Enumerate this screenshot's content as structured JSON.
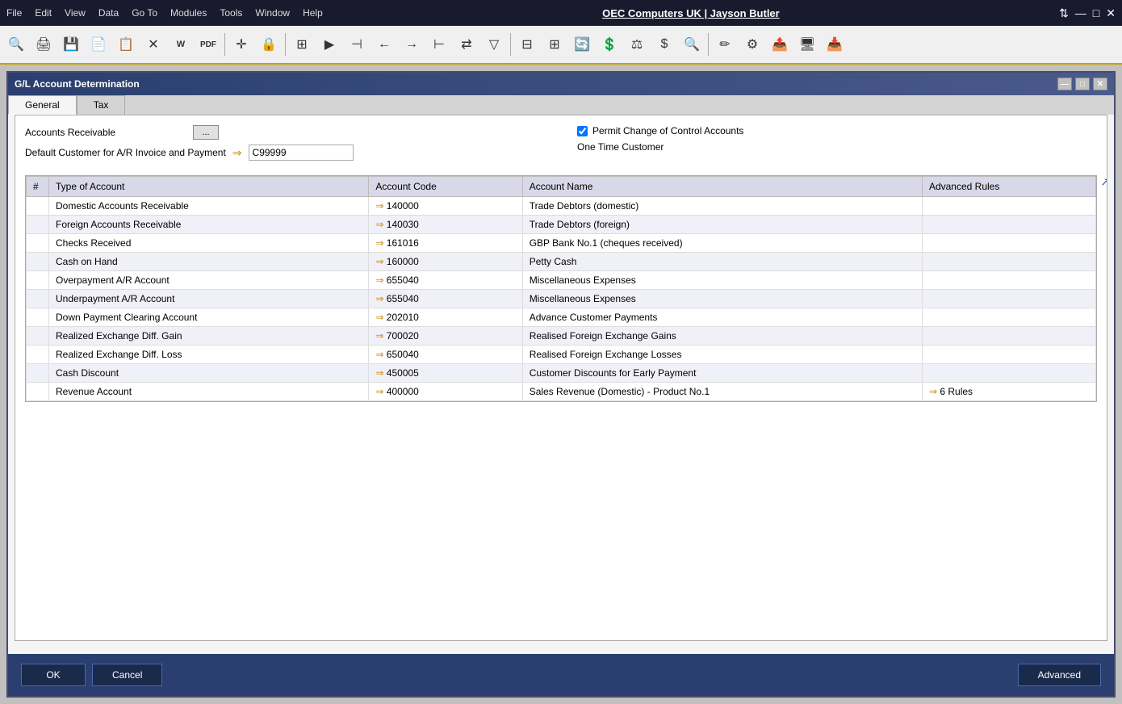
{
  "titlebar": {
    "menu_items": [
      "File",
      "Edit",
      "View",
      "Data",
      "Go To",
      "Modules",
      "Tools",
      "Window",
      "Help"
    ],
    "app_title": "OEC Computers UK | Jayson Butler",
    "controls": [
      "⇅",
      "—",
      "□",
      "✕"
    ]
  },
  "toolbar": {
    "buttons": [
      "🔍",
      "🖨",
      "💾",
      "📄",
      "📋",
      "✕",
      "W",
      "PDF",
      "✛",
      "🔒",
      "📊",
      "▶",
      "⊣",
      "←",
      "→",
      "⊢",
      "⇄",
      "▽",
      "📋",
      "⊞",
      "⊟",
      "🔄",
      "💲",
      "⚖",
      "$",
      "🔍",
      "✏",
      "⚙",
      "📤",
      "🖥",
      "📥"
    ]
  },
  "dialog": {
    "title": "G/L Account Determination",
    "controls": [
      "—",
      "□",
      "✕"
    ],
    "tabs": [
      {
        "label": "General",
        "active": true
      },
      {
        "label": "Tax",
        "active": false
      }
    ],
    "form": {
      "accounts_receivable_label": "Accounts Receivable",
      "accounts_receivable_btn": "...",
      "permit_change_label": "Permit Change of Control Accounts",
      "permit_change_checked": true,
      "default_customer_label": "Default Customer for A/R Invoice and Payment",
      "default_customer_value": "C99999",
      "one_time_customer_label": "One Time Customer"
    },
    "table": {
      "columns": [
        "#",
        "Type of Account",
        "Account Code",
        "Account Name",
        "Advanced Rules"
      ],
      "rows": [
        {
          "num": "",
          "type": "Domestic Accounts Receivable",
          "code": "140000",
          "name": "Trade Debtors (domestic)",
          "advanced": ""
        },
        {
          "num": "",
          "type": "Foreign Accounts Receivable",
          "code": "140030",
          "name": "Trade Debtors (foreign)",
          "advanced": ""
        },
        {
          "num": "",
          "type": "Checks Received",
          "code": "161016",
          "name": "GBP Bank No.1 (cheques received)",
          "advanced": ""
        },
        {
          "num": "",
          "type": "Cash on Hand",
          "code": "160000",
          "name": "Petty Cash",
          "advanced": ""
        },
        {
          "num": "",
          "type": "Overpayment A/R Account",
          "code": "655040",
          "name": "Miscellaneous Expenses",
          "advanced": ""
        },
        {
          "num": "",
          "type": "Underpayment A/R Account",
          "code": "655040",
          "name": "Miscellaneous Expenses",
          "advanced": ""
        },
        {
          "num": "",
          "type": "Down Payment Clearing Account",
          "code": "202010",
          "name": "Advance Customer Payments",
          "advanced": ""
        },
        {
          "num": "",
          "type": "Realized Exchange Diff. Gain",
          "code": "700020",
          "name": "Realised Foreign Exchange Gains",
          "advanced": ""
        },
        {
          "num": "",
          "type": "Realized Exchange Diff. Loss",
          "code": "650040",
          "name": "Realised Foreign Exchange Losses",
          "advanced": ""
        },
        {
          "num": "",
          "type": "Cash Discount",
          "code": "450005",
          "name": "Customer Discounts for Early Payment",
          "advanced": ""
        },
        {
          "num": "",
          "type": "Revenue Account",
          "code": "400000",
          "name": "Sales Revenue (Domestic) - Product No.1",
          "advanced": "6 Rules"
        }
      ]
    },
    "buttons": {
      "ok": "OK",
      "cancel": "Cancel",
      "advanced": "Advanced"
    }
  }
}
